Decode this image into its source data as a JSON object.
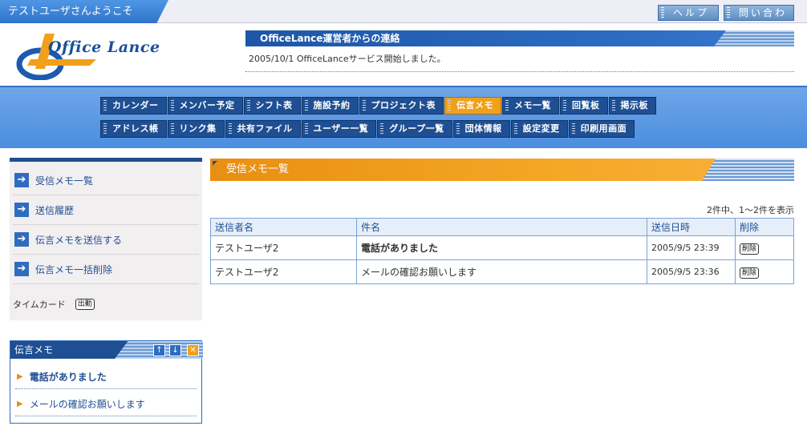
{
  "topbar": {
    "welcome": "テストユーザさんようこそ",
    "help_label": "ヘルプ",
    "contact_label": "問い合わせ"
  },
  "header": {
    "logo_text": "Office Lance",
    "notice_title": "OfficeLance運営者からの連絡",
    "notice_body": "2005/10/1 OfficeLanceサービス開始しました。"
  },
  "nav": {
    "row1": [
      "カレンダー",
      "メンバー予定",
      "シフト表",
      "施設予約",
      "プロジェクト表",
      "伝言メモ",
      "メモ一覧",
      "回覧板",
      "掲示板"
    ],
    "row2": [
      "アドレス帳",
      "リンク集",
      "共有ファイル",
      "ユーザー一覧",
      "グループ一覧",
      "団体情報",
      "設定変更",
      "印刷用画面"
    ],
    "active": "伝言メモ"
  },
  "sidebar": {
    "items": [
      {
        "label": "受信メモ一覧"
      },
      {
        "label": "送信履歴"
      },
      {
        "label": "伝言メモを送信する"
      },
      {
        "label": "伝言メモ一括削除"
      }
    ],
    "timecard_label": "タイムカード",
    "clockin_label": "出勤"
  },
  "widget": {
    "title": "伝言メモ",
    "items": [
      {
        "label": "電話がありました"
      },
      {
        "label": "メールの確認お願いします"
      }
    ]
  },
  "main": {
    "title": "受信メモ一覧",
    "count_text": "2件中、1～2件を表示",
    "columns": [
      "送信者名",
      "件名",
      "送信日時",
      "削除"
    ],
    "rows": [
      {
        "sender": "テストユーザ2",
        "subject": "電話がありました",
        "datetime": "2005/9/5 23:39",
        "delete_label": "削除"
      },
      {
        "sender": "テストユーザ2",
        "subject": "メールの確認お願いします",
        "datetime": "2005/9/5 23:36",
        "delete_label": "削除"
      }
    ]
  },
  "colors": {
    "brand_blue": "#1f4f93",
    "accent_orange": "#f0a01a",
    "nav_band": "#5b96e2"
  }
}
